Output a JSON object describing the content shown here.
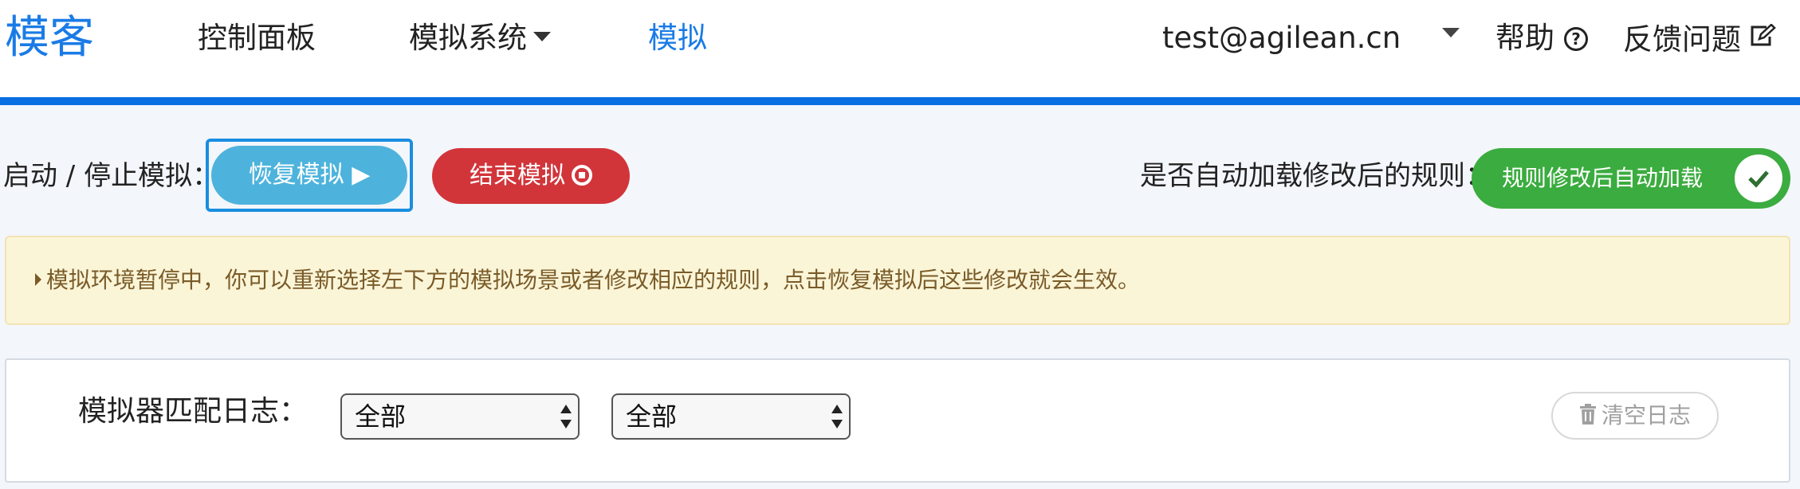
{
  "navbar": {
    "brand": "模客",
    "items": [
      {
        "label": "控制面板"
      },
      {
        "label": "模拟系统"
      },
      {
        "label": "模拟"
      }
    ],
    "user_email": "test@agilean.cn",
    "help_label": "帮助",
    "help_icon": "question-circle-icon",
    "feedback_label": "反馈问题",
    "feedback_icon": "edit-icon",
    "accent_color": "#0a6ee3"
  },
  "sim_control": {
    "label": "启动 / 停止模拟：",
    "resume_button": "恢复模拟 ▶",
    "end_button": "结束模拟",
    "auto_reload_label": "是否自动加载修改后的规则：",
    "auto_reload_button": "规则修改后自动加载",
    "auto_reload_checked": true
  },
  "alert": {
    "message": "模拟环境暂停中，你可以重新选择左下方的模拟场景或者修改相应的规则，点击恢复模拟后这些修改就会生效。"
  },
  "log_panel": {
    "title": "模拟器匹配日志：",
    "filter1_value": "全部",
    "filter2_value": "全部",
    "clear_button": "清空日志"
  },
  "colors": {
    "resume": "#4db3dc",
    "end": "#d1353a",
    "auto": "#3bac3f",
    "alert_bg": "#fbf5d8"
  }
}
